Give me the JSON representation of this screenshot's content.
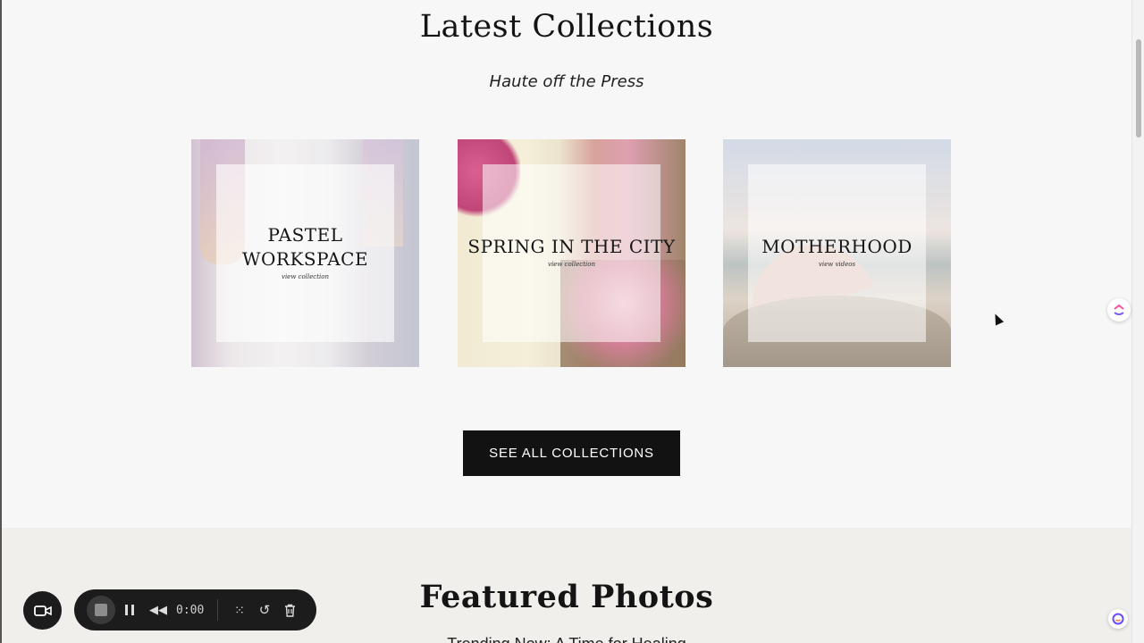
{
  "collections": {
    "title": "Latest Collections",
    "subtitle": "Haute off the Press",
    "cards": [
      {
        "title_line1": "PASTEL",
        "title_line2": "WORKSPACE",
        "link": "view collection"
      },
      {
        "title_line1": "SPRING IN THE CITY",
        "title_line2": "",
        "link": "view collection"
      },
      {
        "title_line1": "MOTHERHOOD",
        "title_line2": "",
        "link": "view videos"
      }
    ],
    "see_all_label": "SEE ALL COLLECTIONS"
  },
  "featured": {
    "title": "Featured Photos",
    "subtitle": "Trending Now: A Time for Healing"
  },
  "recorder": {
    "time": "0:00",
    "icons": {
      "camera": "video-camera-icon",
      "stop": "stop-icon",
      "pause": "pause-icon",
      "rewind": "rewind-icon",
      "grid": "grid-icon",
      "restart": "restart-icon",
      "delete": "trash-icon"
    }
  },
  "extensions": {
    "top_icon": "clickup-icon",
    "bottom_icon": "assistant-icon"
  },
  "colors": {
    "button_bg": "#121212",
    "page_bg": "#f7f7f7",
    "featured_bg": "#f1efec",
    "recorder_bg": "#1c1c1c"
  }
}
